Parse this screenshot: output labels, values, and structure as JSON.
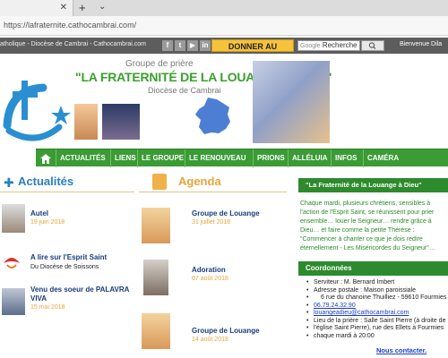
{
  "browser": {
    "url": "https://lafraternite.cathocambrai.com/",
    "newtab": "+",
    "tab_close": "✕",
    "tabs_menu": "⌄"
  },
  "topbar": {
    "title": "atholique - Diocèse de Cambrai - Cathocambrai.com",
    "social": [
      "f",
      "t",
      "▶",
      "in",
      "✉"
    ],
    "donate": "DONNER AU DENIER",
    "search_placeholder": "Recherche",
    "search_brand": "Google",
    "welcome": "Bienvenue Dila"
  },
  "header": {
    "subtitle": "Groupe de prière",
    "title": "\"LA FRATERNITÉ DE LA LOUANGE À DIEU\"",
    "diocese": "Diocèse de Cambrai"
  },
  "nav": {
    "items": [
      "ACTUALITÉS",
      "LIENS",
      "LE GROUPE",
      "LE RENOUVEAU",
      "PRIONS",
      "ALLÉLUIA",
      "INFOS",
      "CAMÉRA"
    ]
  },
  "actualites": {
    "title": "Actualités",
    "items": [
      {
        "title": "Autel",
        "date": "19 juin 2018"
      },
      {
        "title": "A lire sur l'Esprit Saint",
        "sub": "Du Diocèse de Soissons"
      },
      {
        "title": "Venu des soeur de PALAVRA",
        "title2": "VIVA",
        "date": "15 mai 2018"
      }
    ]
  },
  "agenda": {
    "title": "Agenda",
    "items": [
      {
        "title": "Groupe de Louange",
        "date": "31 juillet 2018"
      },
      {
        "title": "Adoration",
        "date": "07 août 2018"
      },
      {
        "title": "Groupe de Louange",
        "date": "14 août 2018"
      }
    ]
  },
  "side": {
    "box1_title": "\"La Fraternité de la Louange à Dieu\"",
    "box1_lines": [
      "Chaque mardi, plusieurs chrétiens, sensibles à",
      "l'action de l'Esprit Saint, se réunissent pour prier",
      "ensemble… louer le Seigneur… rendre grâce à",
      "Dieu… et faire comme la petite Thérèse :",
      "\"Commencer à chanter ce que je dois redire",
      "éternellement - Les Miséricordes du Seigneur\"…"
    ],
    "box2_title": "Coordonnées",
    "contact": [
      "Serviteur : M. Bernard Imbert",
      "Adresse postale : Maison paroissiale",
      "6 rue du chanoine Thuilliez - 59610 Fourmies"
    ],
    "phone": "06.79.24.32.90",
    "email": "louangeadieu@cathocambrai.com",
    "place": [
      "Lieu de la prière : Salle Saint Pierre (à droite de",
      "l'église Saint Pierre), rue des Ellets à Fourmies"
    ],
    "schedule": "chaque mardi à 20:00",
    "contact_link": "Nous contacter."
  },
  "colors": {
    "green": "#3b9b35",
    "blue": "#2a7fc0",
    "orange": "#e8a53a",
    "darkgray": "#5d5d5d"
  }
}
